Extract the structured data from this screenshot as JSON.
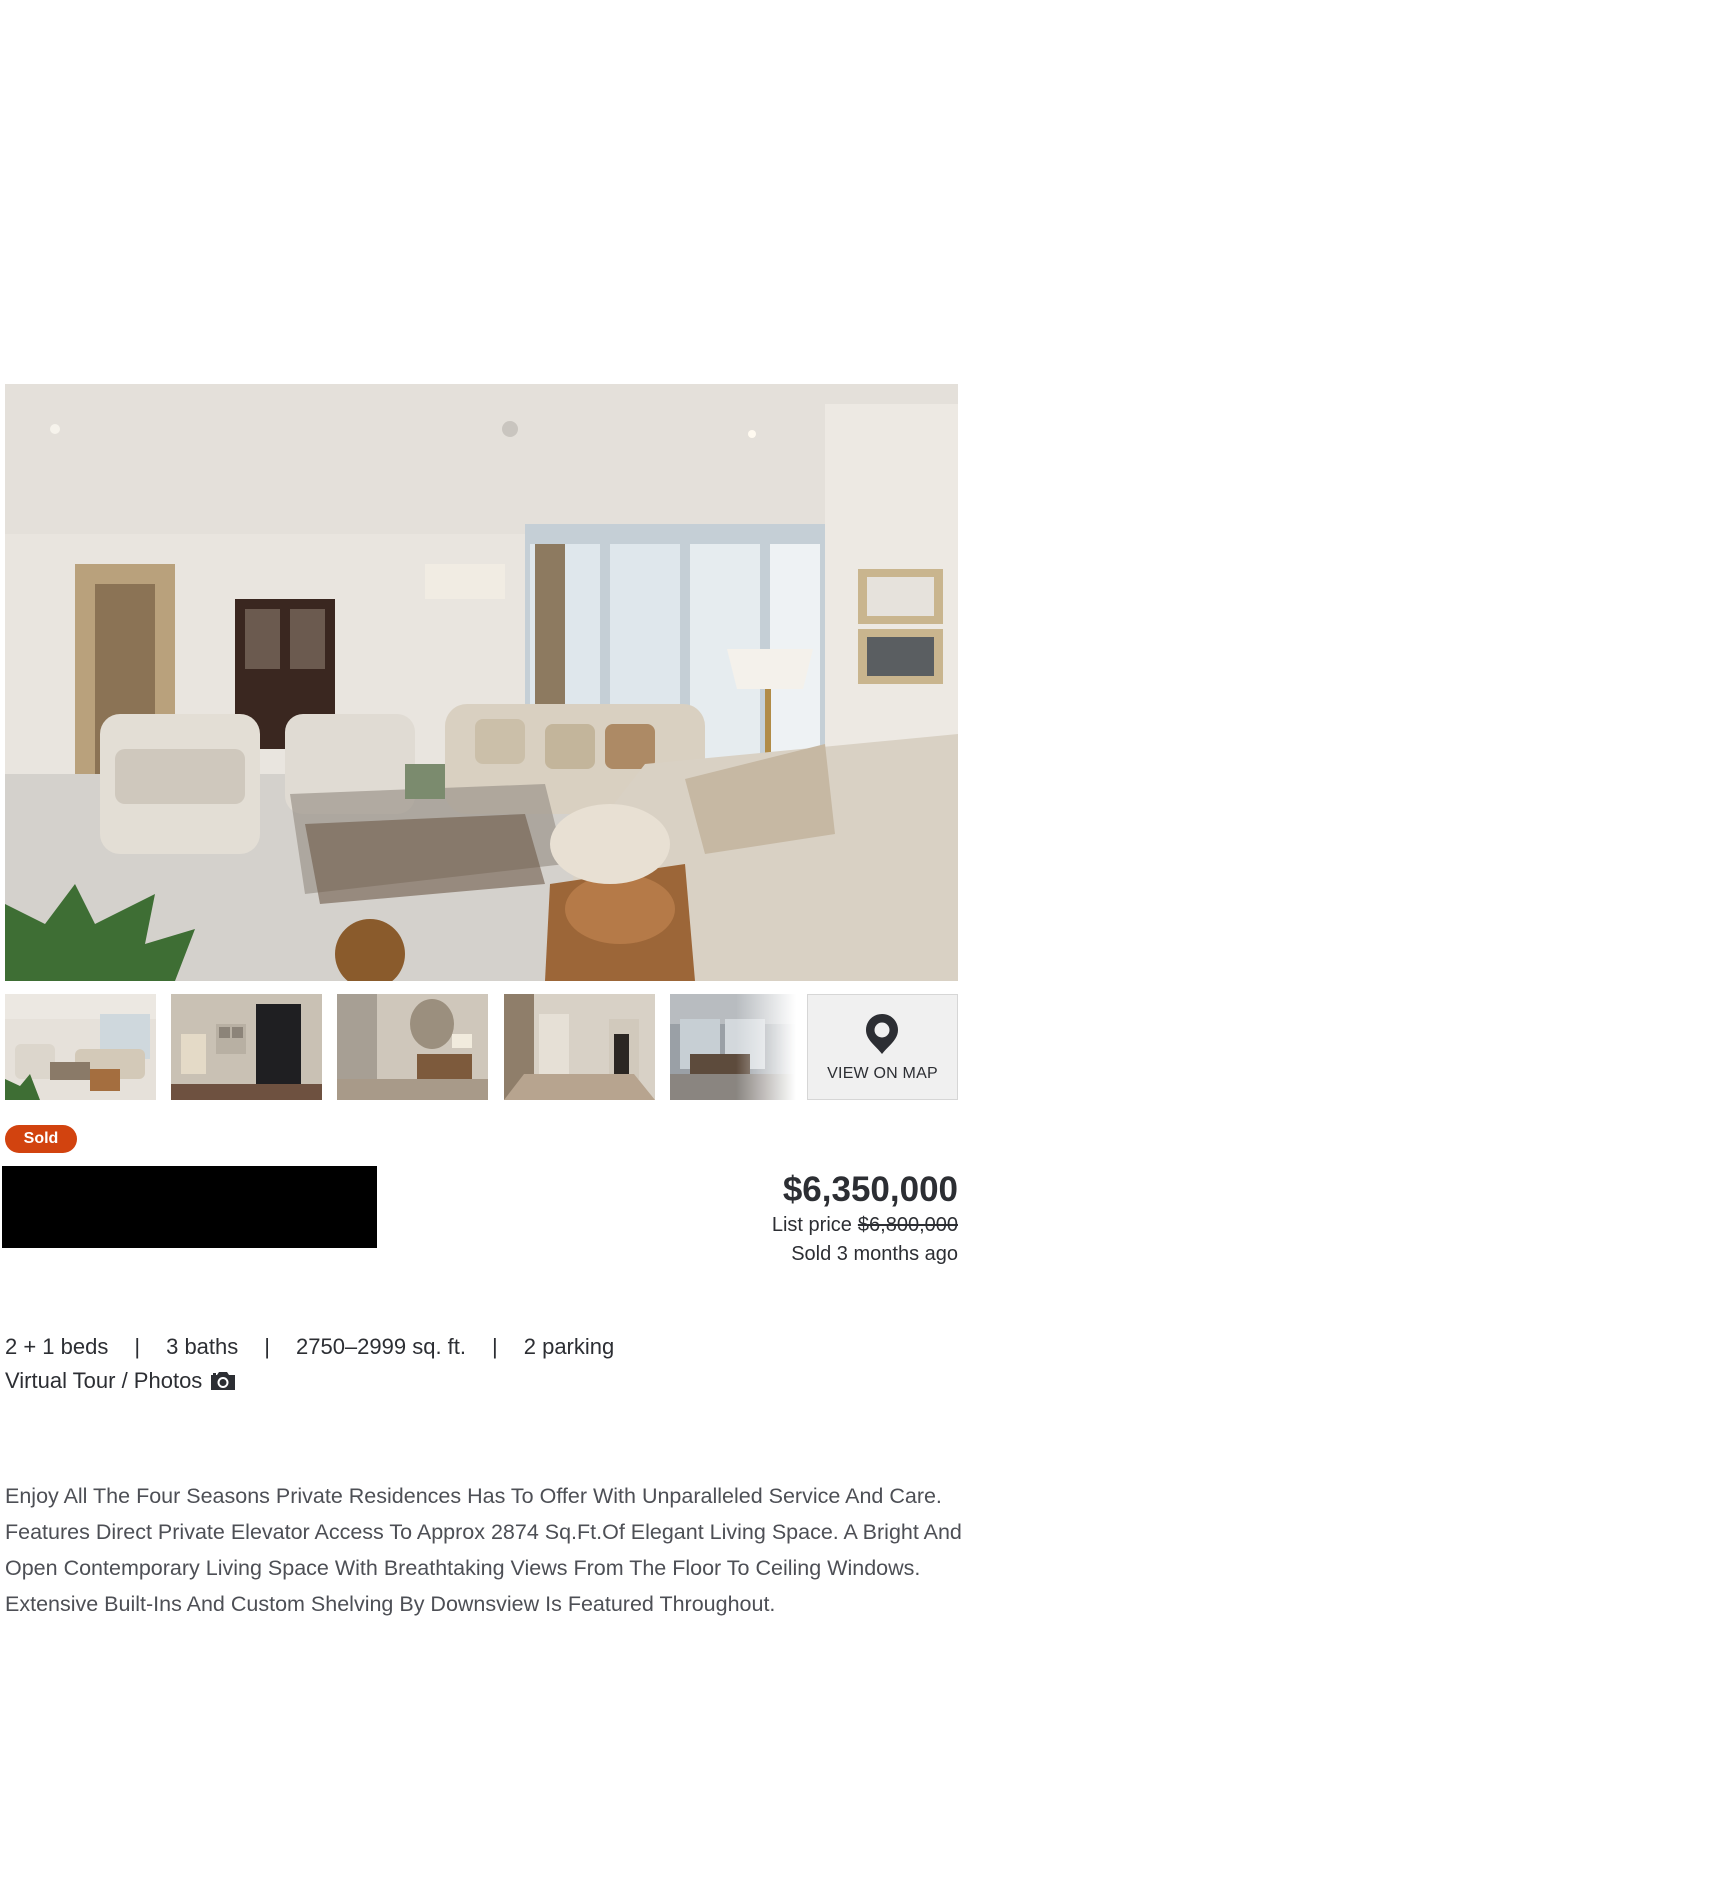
{
  "listing": {
    "status_badge": "Sold",
    "price": "$6,350,000",
    "list_price_label": "List price",
    "list_price_original": "$6,800,000",
    "sold_time": "Sold 3 months ago"
  },
  "gallery": {
    "photo_count_shown": 5,
    "map_button_label": "VIEW ON MAP"
  },
  "stats": {
    "beds": "2 + 1 beds",
    "baths": "3 baths",
    "sqft": "2750–2999 sq. ft.",
    "parking": "2 parking",
    "separator": "|"
  },
  "tour_link": "Virtual Tour / Photos",
  "description": "Enjoy All The Four Seasons Private Residences Has To Offer With Unparalleled Service And Care. Features Direct Private Elevator Access To Approx 2874 Sq.Ft.Of Elegant Living Space. A Bright And Open Contemporary Living Space With Breathtaking Views From The Floor To Ceiling Windows. Extensive Built-Ins And Custom Shelving By Downsview Is Featured Throughout.",
  "icons": {
    "map": "map-pin-icon",
    "camera": "camera-icon"
  },
  "colors": {
    "badge": "#d2430f",
    "text": "#2c2e33",
    "muted_text": "#4d4f55",
    "map_button_bg": "#f0f0f0"
  }
}
